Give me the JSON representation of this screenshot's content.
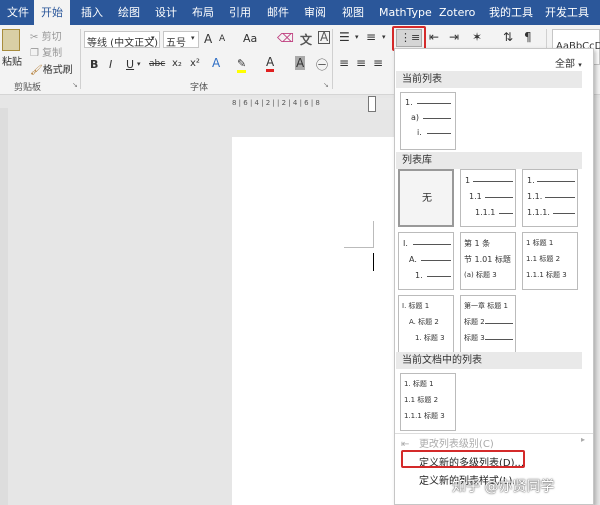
{
  "tabs": [
    "文件",
    "开始",
    "插入",
    "绘图",
    "设计",
    "布局",
    "引用",
    "邮件",
    "审阅",
    "视图",
    "MathType",
    "Zotero",
    "我的工具",
    "开发工具"
  ],
  "clipboard": {
    "paste": "粘贴",
    "cut": "剪切",
    "copy": "复制",
    "format_painter": "格式刷",
    "group": "剪贴板"
  },
  "font": {
    "name": "等线 (中文正文)",
    "size": "五号",
    "group": "字体",
    "grow": "A",
    "shrink": "A",
    "case": "Aa",
    "bold": "B",
    "italic": "I",
    "underline": "U",
    "strike": "abc",
    "subscript": "x₂",
    "superscript": "x²",
    "font_color_letter": "A"
  },
  "styles": {
    "preview": "AaBbCcD"
  },
  "ruler": {
    "marks": "8 | 6 | 4 | 2 | | 2 | 4 | 6 | 8"
  },
  "panel": {
    "filter": "全部",
    "current_header": "当前列表",
    "current_list": [
      "1.",
      "a)",
      "i."
    ],
    "library_header": "列表库",
    "none_label": "无",
    "lib1": [
      "1",
      "1.1",
      "1.1.1"
    ],
    "lib2": [
      "1.",
      "1.1.",
      "1.1.1."
    ],
    "lib3": [
      "I.",
      "A.",
      "1."
    ],
    "lib4": [
      "第 1 条",
      "节 1.01 标题",
      "(a) 标题 3"
    ],
    "lib5": [
      "1 标题 1",
      "1.1 标题 2",
      "1.1.1 标题 3"
    ],
    "lib6": [
      "I. 标题 1",
      "A. 标题 2",
      "1. 标题 3"
    ],
    "lib7": [
      "第一章 标题 1",
      "标题 2",
      "标题 3"
    ],
    "doc_header": "当前文档中的列表",
    "doc_list": [
      "1. 标题 1",
      "1.1 标题 2",
      "1.1.1 标题 3"
    ],
    "change_level": "更改列表级别(C)",
    "define_multi": "定义新的多级列表(D)...",
    "define_style": "定义新的列表样式(L)..."
  },
  "watermark": "知乎 @亦贤同学",
  "colors": {
    "ribbon_blue": "#2b579a",
    "highlight_red": "#d42a2a",
    "font_color": "#e02020",
    "highlight_yellow": "#ffff00"
  }
}
